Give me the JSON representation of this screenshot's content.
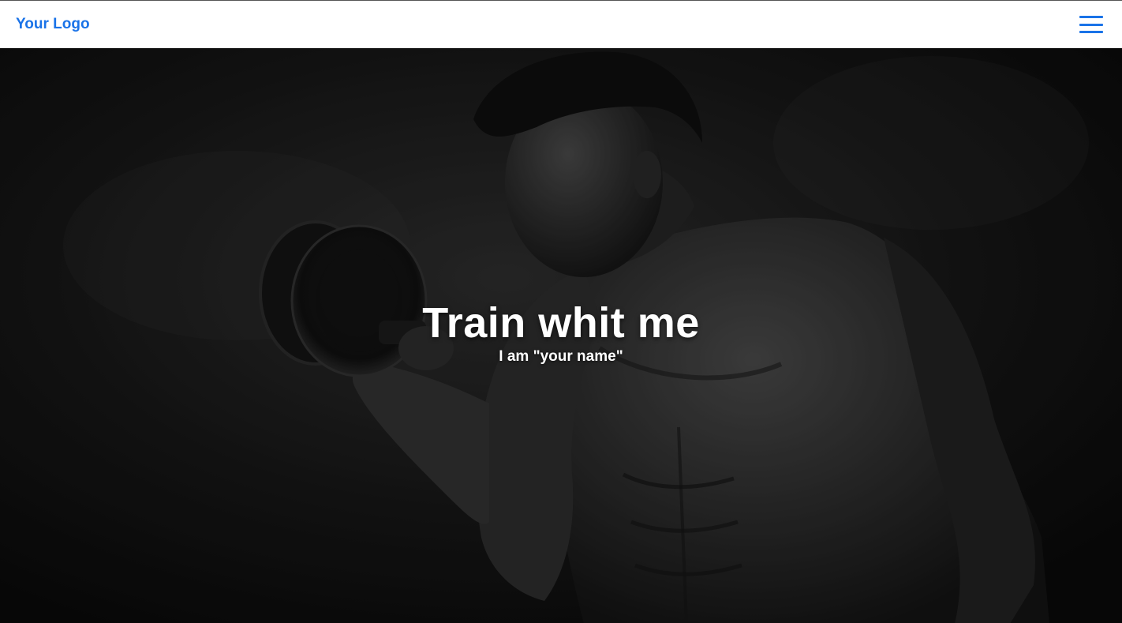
{
  "navbar": {
    "logo_text": "Your Logo",
    "menu_icon": "hamburger-menu-icon"
  },
  "hero": {
    "title": "Train whit me",
    "subtitle": "I am \"your name\"",
    "background_image": "muscular man lifting dumbbell, black and white photo"
  },
  "colors": {
    "accent": "#1a73e8",
    "hero_bg": "#111111",
    "hero_text": "#ffffff",
    "navbar_bg": "#ffffff"
  }
}
